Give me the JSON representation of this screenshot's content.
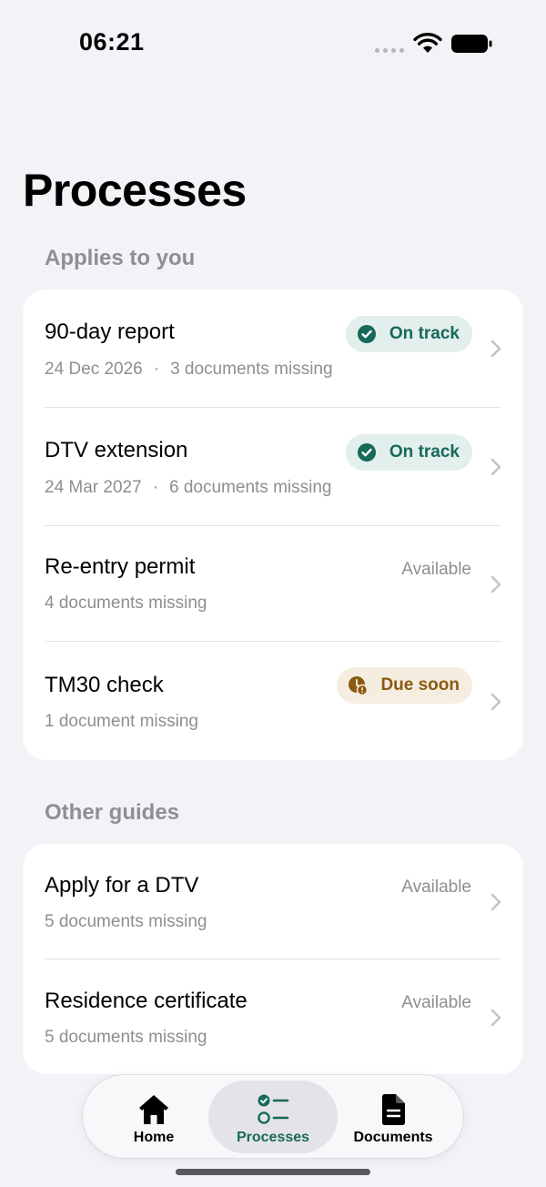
{
  "status_bar": {
    "time": "06:21"
  },
  "page": {
    "title": "Processes"
  },
  "sections": {
    "applies": "Applies to you",
    "other": "Other guides"
  },
  "applies_items": [
    {
      "title": "90-day report",
      "date": "24 Dec 2026",
      "sep": "·",
      "missing": "3 documents missing",
      "status": "On track"
    },
    {
      "title": "DTV extension",
      "date": "24 Mar 2027",
      "sep": "·",
      "missing": "6 documents missing",
      "status": "On track"
    },
    {
      "title": "Re-entry permit",
      "missing": "4 documents missing",
      "status": "Available"
    },
    {
      "title": "TM30 check",
      "missing": "1 document missing",
      "status": "Due soon"
    }
  ],
  "other_items": [
    {
      "title": "Apply for a DTV",
      "missing": "5 documents missing",
      "status": "Available"
    },
    {
      "title": "Residence certificate",
      "missing": "5 documents missing",
      "status": "Available"
    }
  ],
  "tabs": {
    "home": "Home",
    "processes": "Processes",
    "documents": "Documents",
    "active": "processes"
  },
  "colors": {
    "accent": "#17695a",
    "on_track_bg": "#e2efec",
    "due_soon": "#8a5a12",
    "due_soon_bg": "#f5eddf",
    "background": "#f2f2f7"
  },
  "icons": {
    "on_track": "check-circle-icon",
    "due_soon": "clock-alert-icon",
    "row": "chevron-right-icon",
    "home": "house-icon",
    "processes": "checklist-icon",
    "documents": "document-icon"
  }
}
